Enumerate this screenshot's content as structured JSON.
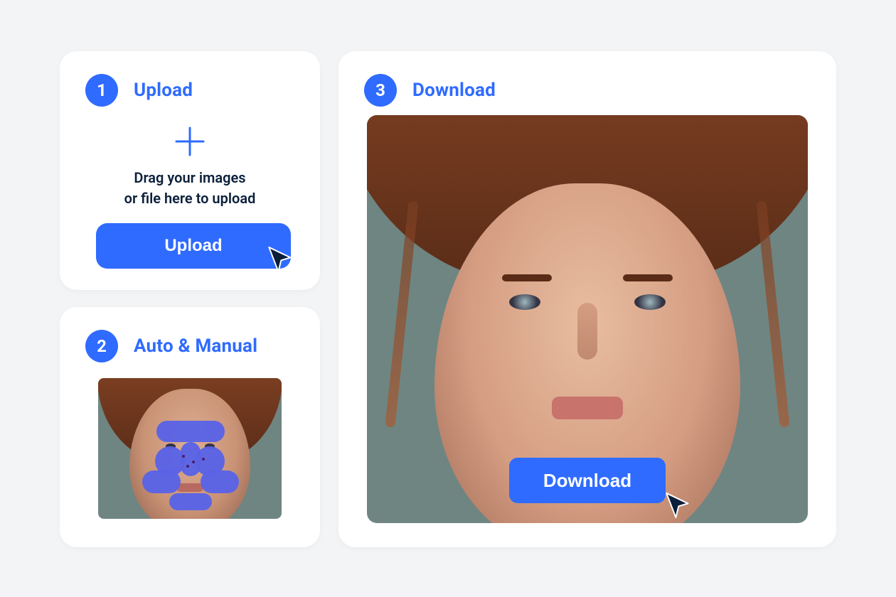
{
  "colors": {
    "accent": "#2f6bff"
  },
  "steps": {
    "upload": {
      "number": "1",
      "title": "Upload",
      "drop_text_line1": "Drag your images",
      "drop_text_line2": "or file here to upload",
      "button_label": "Upload"
    },
    "auto_manual": {
      "number": "2",
      "title": "Auto &  Manual"
    },
    "download": {
      "number": "3",
      "title": "Download",
      "button_label": "Download"
    }
  }
}
